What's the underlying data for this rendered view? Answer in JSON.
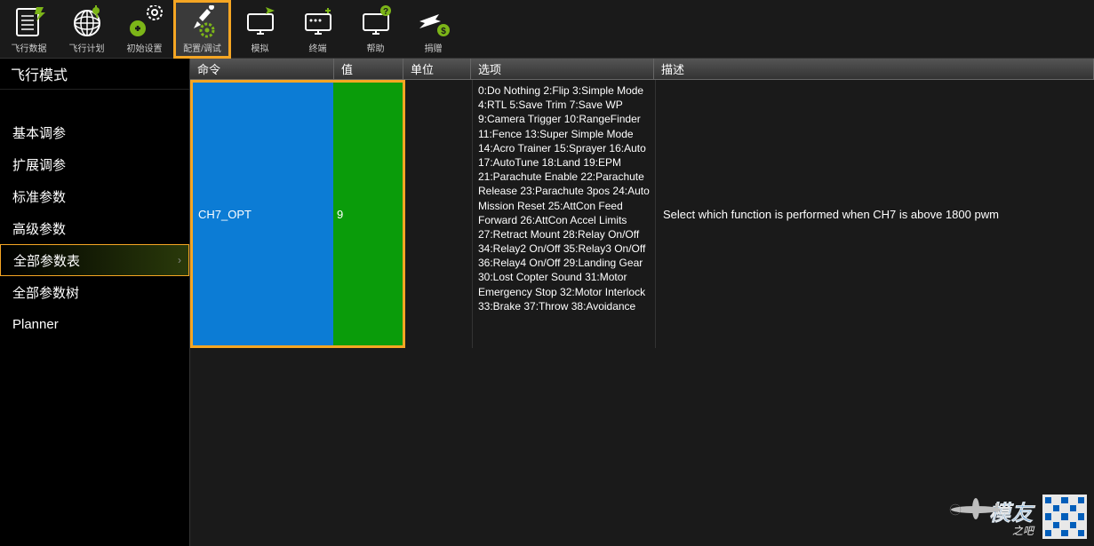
{
  "toolbar": {
    "items": [
      {
        "label": "飞行数据",
        "icon": "data"
      },
      {
        "label": "飞行计划",
        "icon": "plan"
      },
      {
        "label": "初始设置",
        "icon": "setup"
      },
      {
        "label": "配置/调试",
        "icon": "config",
        "highlighted": true
      },
      {
        "label": "模拟",
        "icon": "sim"
      },
      {
        "label": "终端",
        "icon": "terminal"
      },
      {
        "label": "帮助",
        "icon": "help"
      },
      {
        "label": "捐赠",
        "icon": "donate"
      }
    ]
  },
  "sidebar": {
    "title": "飞行模式",
    "items": [
      {
        "label": "基本调参"
      },
      {
        "label": "扩展调参"
      },
      {
        "label": "标准参数"
      },
      {
        "label": "高级参数"
      },
      {
        "label": "全部参数表",
        "selected": true
      },
      {
        "label": "全部参数树"
      },
      {
        "label": "Planner"
      }
    ]
  },
  "table": {
    "headers": {
      "cmd": "命令",
      "val": "值",
      "unit": "单位",
      "opt": "选项",
      "desc": "描述"
    },
    "row": {
      "cmd": "CH7_OPT",
      "val": "9",
      "unit": "",
      "opt": "0:Do Nothing  2:Flip  3:Simple Mode  4:RTL  5:Save Trim  7:Save WP  9:Camera Trigger  10:RangeFinder  11:Fence  13:Super Simple Mode  14:Acro Trainer  15:Sprayer  16:Auto  17:AutoTune  18:Land  19:EPM  21:Parachute Enable  22:Parachute Release  23:Parachute 3pos  24:Auto Mission Reset  25:AttCon Feed Forward  26:AttCon Accel Limits  27:Retract Mount  28:Relay On/Off  34:Relay2 On/Off  35:Relay3 On/Off  36:Relay4 On/Off  29:Landing Gear  30:Lost Copter Sound  31:Motor Emergency Stop  32:Motor Interlock  33:Brake  37:Throw  38:Avoidance",
      "desc": "Select which function is performed when CH7 is above 1800 pwm"
    }
  },
  "watermark": {
    "text1": "模友",
    "text2": "之吧"
  }
}
